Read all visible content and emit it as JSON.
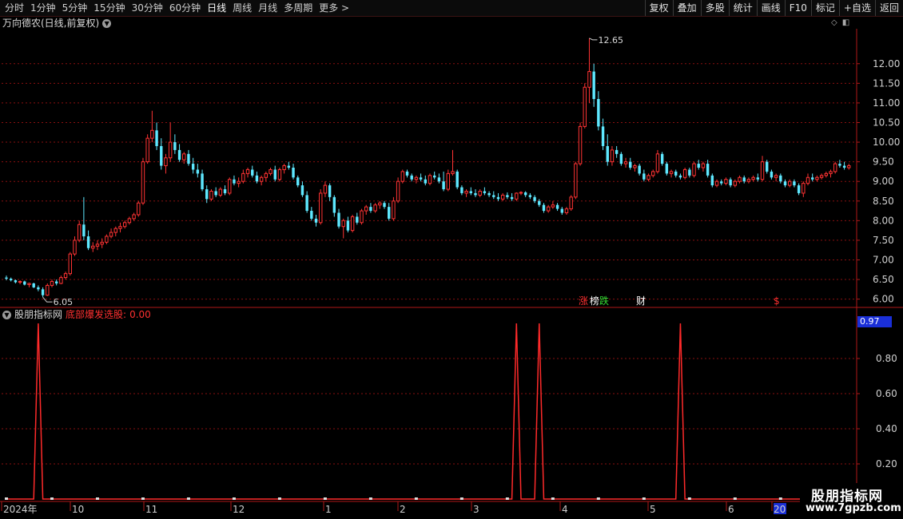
{
  "toolbar": {
    "periods": [
      "分时",
      "1分钟",
      "5分钟",
      "15分钟",
      "30分钟",
      "60分钟",
      "日线",
      "周线",
      "月线",
      "多周期",
      "更多 >"
    ],
    "active_index": 6,
    "buttons": [
      "复权",
      "叠加",
      "多股",
      "统计",
      "画线",
      "F10",
      "标记",
      "+自选",
      "返回"
    ]
  },
  "stock": {
    "title": "万向德农(日线,前复权)"
  },
  "indicator": {
    "name": "股朋指标网",
    "formula": "底部爆发选股:",
    "value": "0.00",
    "current_readout": "0.97"
  },
  "price_axis": {
    "ticks": [
      6.0,
      6.5,
      7.0,
      7.5,
      8.0,
      8.5,
      9.0,
      9.5,
      10.0,
      10.5,
      11.0,
      11.5,
      12.0
    ],
    "range": [
      5.85,
      12.85
    ]
  },
  "indicator_axis": {
    "ticks": [
      0.2,
      0.4,
      0.6,
      0.8
    ],
    "range": [
      0,
      1
    ]
  },
  "annotations": {
    "high_label": "12.65",
    "low_label": "6.05"
  },
  "event_markers": [
    {
      "text": "涨",
      "color": "#ff3030"
    },
    {
      "text": "榜",
      "color": "#ffffff"
    },
    {
      "text": "跌",
      "color": "#33dd33"
    },
    {
      "text": "财",
      "color": "#ffffff"
    },
    {
      "text": "$",
      "color": "#ff3030"
    }
  ],
  "time_axis": {
    "labels": [
      "2024年",
      "10",
      "11",
      "12",
      "1",
      "2",
      "3",
      "4",
      "5",
      "6",
      "20"
    ]
  },
  "colors": {
    "up": "#ff3333",
    "down": "#5ee8ff",
    "grid": "#8a1010",
    "signal": "#ff2a2a"
  },
  "chart_data": {
    "type": "candlestick",
    "candles": [
      [
        6.55,
        6.6,
        6.48,
        6.52
      ],
      [
        6.52,
        6.55,
        6.45,
        6.48
      ],
      [
        6.48,
        6.5,
        6.4,
        6.43
      ],
      [
        6.43,
        6.48,
        6.38,
        6.45
      ],
      [
        6.45,
        6.47,
        6.35,
        6.37
      ],
      [
        6.37,
        6.42,
        6.3,
        6.4
      ],
      [
        6.4,
        6.42,
        6.28,
        6.3
      ],
      [
        6.3,
        6.35,
        6.2,
        6.25
      ],
      [
        6.25,
        6.3,
        6.05,
        6.1
      ],
      [
        6.1,
        6.4,
        6.08,
        6.35
      ],
      [
        6.35,
        6.5,
        6.3,
        6.45
      ],
      [
        6.45,
        6.5,
        6.35,
        6.4
      ],
      [
        6.4,
        6.6,
        6.38,
        6.55
      ],
      [
        6.55,
        6.7,
        6.5,
        6.65
      ],
      [
        6.65,
        7.2,
        6.6,
        7.15
      ],
      [
        7.15,
        7.6,
        7.1,
        7.5
      ],
      [
        7.5,
        8.0,
        7.45,
        7.9
      ],
      [
        7.9,
        8.6,
        7.5,
        7.6
      ],
      [
        7.6,
        7.75,
        7.25,
        7.3
      ],
      [
        7.3,
        7.45,
        7.2,
        7.35
      ],
      [
        7.35,
        7.5,
        7.25,
        7.4
      ],
      [
        7.4,
        7.55,
        7.3,
        7.45
      ],
      [
        7.45,
        7.65,
        7.4,
        7.6
      ],
      [
        7.6,
        7.8,
        7.55,
        7.7
      ],
      [
        7.7,
        7.85,
        7.6,
        7.8
      ],
      [
        7.8,
        7.95,
        7.7,
        7.85
      ],
      [
        7.85,
        8.0,
        7.8,
        7.95
      ],
      [
        7.95,
        8.1,
        7.9,
        8.05
      ],
      [
        8.05,
        8.2,
        8.0,
        8.15
      ],
      [
        8.15,
        8.5,
        8.1,
        8.45
      ],
      [
        8.45,
        9.6,
        8.4,
        9.5
      ],
      [
        9.5,
        10.2,
        9.45,
        10.1
      ],
      [
        10.1,
        10.8,
        10.0,
        10.3
      ],
      [
        10.3,
        10.5,
        9.8,
        9.9
      ],
      [
        9.9,
        10.1,
        9.3,
        9.4
      ],
      [
        9.4,
        9.7,
        9.2,
        9.6
      ],
      [
        9.6,
        10.5,
        9.5,
        10.0
      ],
      [
        10.0,
        10.2,
        9.7,
        9.8
      ],
      [
        9.8,
        9.95,
        9.5,
        9.55
      ],
      [
        9.55,
        9.75,
        9.45,
        9.7
      ],
      [
        9.7,
        9.8,
        9.4,
        9.45
      ],
      [
        9.45,
        9.6,
        9.2,
        9.3
      ],
      [
        9.3,
        9.45,
        9.1,
        9.2
      ],
      [
        9.2,
        9.3,
        8.75,
        8.8
      ],
      [
        8.8,
        8.9,
        8.45,
        8.55
      ],
      [
        8.55,
        8.8,
        8.5,
        8.75
      ],
      [
        8.75,
        8.85,
        8.6,
        8.65
      ],
      [
        8.65,
        8.85,
        8.6,
        8.8
      ],
      [
        8.8,
        8.9,
        8.65,
        8.7
      ],
      [
        8.7,
        9.1,
        8.65,
        9.05
      ],
      [
        9.05,
        9.15,
        8.9,
        8.95
      ],
      [
        8.95,
        9.1,
        8.85,
        9.0
      ],
      [
        9.0,
        9.3,
        8.95,
        9.2
      ],
      [
        9.2,
        9.35,
        9.1,
        9.3
      ],
      [
        9.3,
        9.4,
        9.1,
        9.15
      ],
      [
        9.15,
        9.25,
        8.95,
        9.0
      ],
      [
        9.0,
        9.15,
        8.9,
        9.1
      ],
      [
        9.1,
        9.25,
        9.0,
        9.2
      ],
      [
        9.2,
        9.35,
        9.15,
        9.3
      ],
      [
        9.3,
        9.4,
        9.0,
        9.05
      ],
      [
        9.05,
        9.35,
        9.0,
        9.3
      ],
      [
        9.3,
        9.45,
        9.2,
        9.4
      ],
      [
        9.4,
        9.5,
        9.3,
        9.35
      ],
      [
        9.35,
        9.45,
        9.05,
        9.1
      ],
      [
        9.1,
        9.15,
        8.85,
        8.9
      ],
      [
        8.9,
        9.0,
        8.6,
        8.65
      ],
      [
        8.65,
        8.75,
        8.2,
        8.25
      ],
      [
        8.25,
        8.35,
        8.0,
        8.05
      ],
      [
        8.05,
        8.15,
        7.85,
        7.95
      ],
      [
        7.95,
        8.8,
        7.9,
        8.7
      ],
      [
        8.7,
        9.0,
        8.6,
        8.9
      ],
      [
        8.9,
        8.95,
        8.5,
        8.6
      ],
      [
        8.6,
        8.65,
        8.1,
        8.2
      ],
      [
        8.2,
        8.3,
        7.8,
        7.85
      ],
      [
        7.85,
        8.05,
        7.55,
        8.0
      ],
      [
        8.0,
        8.1,
        7.7,
        7.75
      ],
      [
        7.75,
        8.15,
        7.7,
        8.1
      ],
      [
        8.1,
        8.2,
        7.9,
        7.95
      ],
      [
        7.95,
        8.3,
        7.9,
        8.25
      ],
      [
        8.25,
        8.4,
        8.15,
        8.35
      ],
      [
        8.35,
        8.45,
        8.2,
        8.25
      ],
      [
        8.25,
        8.45,
        8.2,
        8.4
      ],
      [
        8.4,
        8.5,
        8.3,
        8.45
      ],
      [
        8.45,
        8.5,
        8.3,
        8.35
      ],
      [
        8.35,
        8.45,
        8.0,
        8.05
      ],
      [
        8.05,
        8.6,
        8.0,
        8.5
      ],
      [
        8.5,
        9.1,
        8.45,
        9.0
      ],
      [
        9.0,
        9.3,
        8.95,
        9.25
      ],
      [
        9.25,
        9.3,
        9.1,
        9.15
      ],
      [
        9.15,
        9.2,
        9.0,
        9.05
      ],
      [
        9.05,
        9.15,
        8.95,
        9.1
      ],
      [
        9.1,
        9.2,
        9.0,
        9.05
      ],
      [
        9.05,
        9.15,
        8.9,
        8.95
      ],
      [
        8.95,
        9.2,
        8.9,
        9.15
      ],
      [
        9.15,
        9.25,
        9.05,
        9.1
      ],
      [
        9.1,
        9.2,
        8.95,
        9.0
      ],
      [
        9.0,
        9.25,
        8.75,
        8.8
      ],
      [
        8.8,
        9.3,
        8.75,
        9.2
      ],
      [
        9.2,
        9.8,
        9.15,
        9.25
      ],
      [
        9.25,
        9.3,
        8.8,
        8.85
      ],
      [
        8.85,
        8.9,
        8.65,
        8.7
      ],
      [
        8.7,
        8.8,
        8.6,
        8.75
      ],
      [
        8.75,
        8.85,
        8.65,
        8.7
      ],
      [
        8.7,
        8.8,
        8.6,
        8.65
      ],
      [
        8.65,
        8.8,
        8.6,
        8.75
      ],
      [
        8.75,
        8.85,
        8.65,
        8.7
      ],
      [
        8.7,
        8.75,
        8.6,
        8.65
      ],
      [
        8.65,
        8.75,
        8.55,
        8.6
      ],
      [
        8.6,
        8.7,
        8.5,
        8.55
      ],
      [
        8.55,
        8.7,
        8.5,
        8.65
      ],
      [
        8.65,
        8.72,
        8.55,
        8.6
      ],
      [
        8.6,
        8.7,
        8.5,
        8.55
      ],
      [
        8.55,
        8.72,
        8.5,
        8.7
      ],
      [
        8.7,
        8.75,
        8.65,
        8.72
      ],
      [
        8.72,
        8.75,
        8.6,
        8.65
      ],
      [
        8.65,
        8.7,
        8.55,
        8.6
      ],
      [
        8.6,
        8.65,
        8.45,
        8.5
      ],
      [
        8.5,
        8.55,
        8.35,
        8.4
      ],
      [
        8.4,
        8.45,
        8.2,
        8.25
      ],
      [
        8.25,
        8.4,
        8.2,
        8.35
      ],
      [
        8.35,
        8.5,
        8.3,
        8.4
      ],
      [
        8.4,
        8.45,
        8.25,
        8.3
      ],
      [
        8.3,
        8.35,
        8.15,
        8.2
      ],
      [
        8.2,
        8.35,
        8.15,
        8.3
      ],
      [
        8.3,
        8.65,
        8.25,
        8.6
      ],
      [
        8.6,
        9.5,
        8.55,
        9.45
      ],
      [
        9.45,
        10.5,
        9.4,
        10.4
      ],
      [
        10.4,
        11.5,
        10.35,
        11.4
      ],
      [
        11.4,
        12.65,
        11.0,
        11.8
      ],
      [
        11.8,
        12.0,
        10.9,
        11.1
      ],
      [
        11.1,
        11.3,
        10.3,
        10.4
      ],
      [
        10.4,
        10.6,
        9.8,
        9.9
      ],
      [
        9.9,
        10.2,
        9.4,
        9.5
      ],
      [
        9.5,
        9.9,
        9.4,
        9.8
      ],
      [
        9.8,
        9.9,
        9.6,
        9.7
      ],
      [
        9.7,
        9.75,
        9.4,
        9.45
      ],
      [
        9.45,
        9.6,
        9.35,
        9.5
      ],
      [
        9.5,
        9.6,
        9.3,
        9.35
      ],
      [
        9.35,
        9.45,
        9.25,
        9.4
      ],
      [
        9.4,
        9.45,
        9.15,
        9.2
      ],
      [
        9.2,
        9.3,
        9.0,
        9.05
      ],
      [
        9.05,
        9.2,
        9.0,
        9.15
      ],
      [
        9.15,
        9.3,
        9.1,
        9.25
      ],
      [
        9.25,
        9.8,
        9.2,
        9.7
      ],
      [
        9.7,
        9.75,
        9.4,
        9.45
      ],
      [
        9.45,
        9.5,
        9.15,
        9.2
      ],
      [
        9.2,
        9.3,
        9.1,
        9.25
      ],
      [
        9.25,
        9.3,
        9.1,
        9.15
      ],
      [
        9.15,
        9.2,
        9.05,
        9.1
      ],
      [
        9.1,
        9.35,
        9.05,
        9.3
      ],
      [
        9.3,
        9.35,
        9.1,
        9.15
      ],
      [
        9.15,
        9.5,
        9.1,
        9.45
      ],
      [
        9.45,
        9.55,
        9.3,
        9.35
      ],
      [
        9.35,
        9.5,
        9.25,
        9.45
      ],
      [
        9.45,
        9.55,
        9.1,
        9.15
      ],
      [
        9.15,
        9.2,
        8.85,
        8.9
      ],
      [
        8.9,
        9.05,
        8.85,
        9.0
      ],
      [
        9.0,
        9.05,
        8.9,
        8.95
      ],
      [
        8.95,
        9.1,
        8.9,
        9.05
      ],
      [
        9.05,
        9.1,
        8.85,
        8.9
      ],
      [
        8.9,
        9.05,
        8.85,
        9.0
      ],
      [
        9.0,
        9.15,
        8.95,
        9.1
      ],
      [
        9.1,
        9.15,
        8.95,
        9.0
      ],
      [
        9.0,
        9.1,
        8.95,
        9.05
      ],
      [
        9.05,
        9.15,
        9.0,
        9.1
      ],
      [
        9.1,
        9.2,
        9.0,
        9.05
      ],
      [
        9.05,
        9.65,
        9.0,
        9.5
      ],
      [
        9.5,
        9.55,
        9.2,
        9.25
      ],
      [
        9.25,
        9.3,
        9.05,
        9.1
      ],
      [
        9.1,
        9.2,
        9.0,
        9.15
      ],
      [
        9.15,
        9.2,
        8.95,
        9.0
      ],
      [
        9.0,
        9.05,
        8.85,
        8.9
      ],
      [
        8.9,
        9.05,
        8.85,
        9.0
      ],
      [
        9.0,
        9.05,
        8.85,
        8.9
      ],
      [
        8.9,
        8.95,
        8.65,
        8.7
      ],
      [
        8.7,
        9.0,
        8.6,
        8.95
      ],
      [
        8.95,
        9.2,
        8.9,
        9.1
      ],
      [
        9.1,
        9.2,
        9.0,
        9.05
      ],
      [
        9.05,
        9.15,
        9.0,
        9.1
      ],
      [
        9.1,
        9.2,
        9.05,
        9.15
      ],
      [
        9.15,
        9.25,
        9.1,
        9.2
      ],
      [
        9.2,
        9.3,
        9.1,
        9.25
      ],
      [
        9.25,
        9.5,
        9.2,
        9.45
      ],
      [
        9.45,
        9.55,
        9.35,
        9.4
      ],
      [
        9.4,
        9.5,
        9.3,
        9.35
      ],
      [
        9.35,
        9.45,
        9.3,
        9.4
      ]
    ],
    "signal_days": [
      7,
      112,
      117,
      148
    ],
    "signal_peak": 1.0
  }
}
